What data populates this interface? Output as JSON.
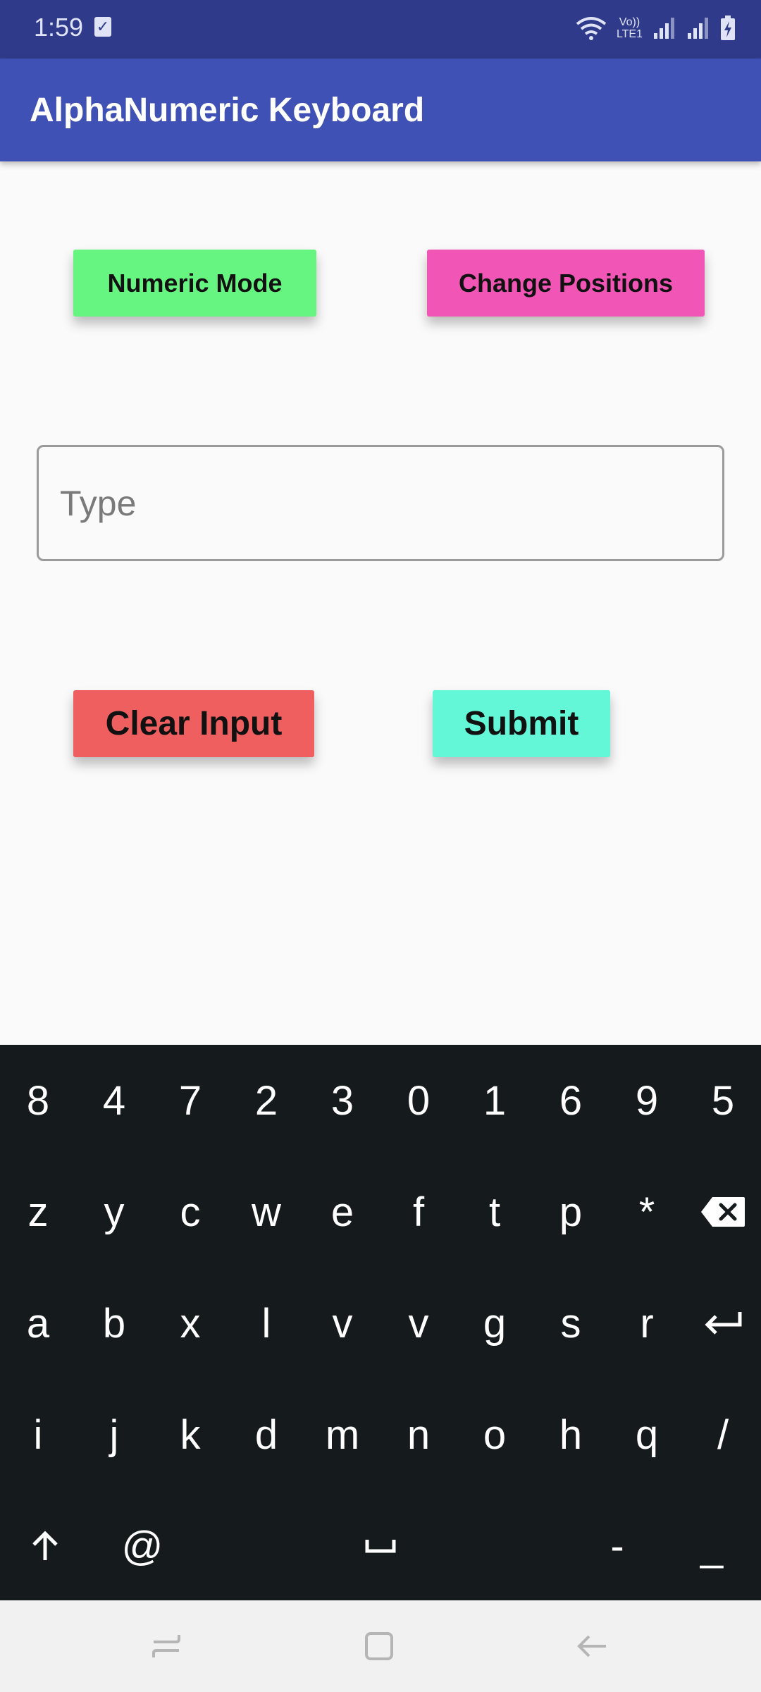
{
  "status_bar": {
    "time": "1:59",
    "network_label_top": "Vo))",
    "network_label_bottom": "LTE1"
  },
  "app_bar": {
    "title": "AlphaNumeric Keyboard"
  },
  "buttons": {
    "numeric_mode": "Numeric Mode",
    "change_positions": "Change Positions",
    "clear_input": "Clear Input",
    "submit": "Submit"
  },
  "input": {
    "placeholder": "Type",
    "value": ""
  },
  "keyboard": {
    "row1": [
      "8",
      "4",
      "7",
      "2",
      "3",
      "0",
      "1",
      "6",
      "9",
      "5"
    ],
    "row2": [
      "z",
      "y",
      "c",
      "w",
      "e",
      "f",
      "t",
      "p",
      "*"
    ],
    "row3": [
      "a",
      "b",
      "x",
      "l",
      "v",
      "v",
      "g",
      "s",
      "r"
    ],
    "row4": [
      "i",
      "j",
      "k",
      "d",
      "m",
      "n",
      "o",
      "h",
      "q",
      "/"
    ],
    "row5": {
      "at": "@",
      "dash": "-",
      "underscore": "_"
    }
  },
  "colors": {
    "status_bar": "#2f3b8a",
    "app_bar": "#4051b5",
    "numeric_mode": "#67f582",
    "change_positions": "#f155b6",
    "clear_input": "#ef5f5f",
    "submit": "#63f7d8",
    "keyboard": "#151a1c"
  }
}
